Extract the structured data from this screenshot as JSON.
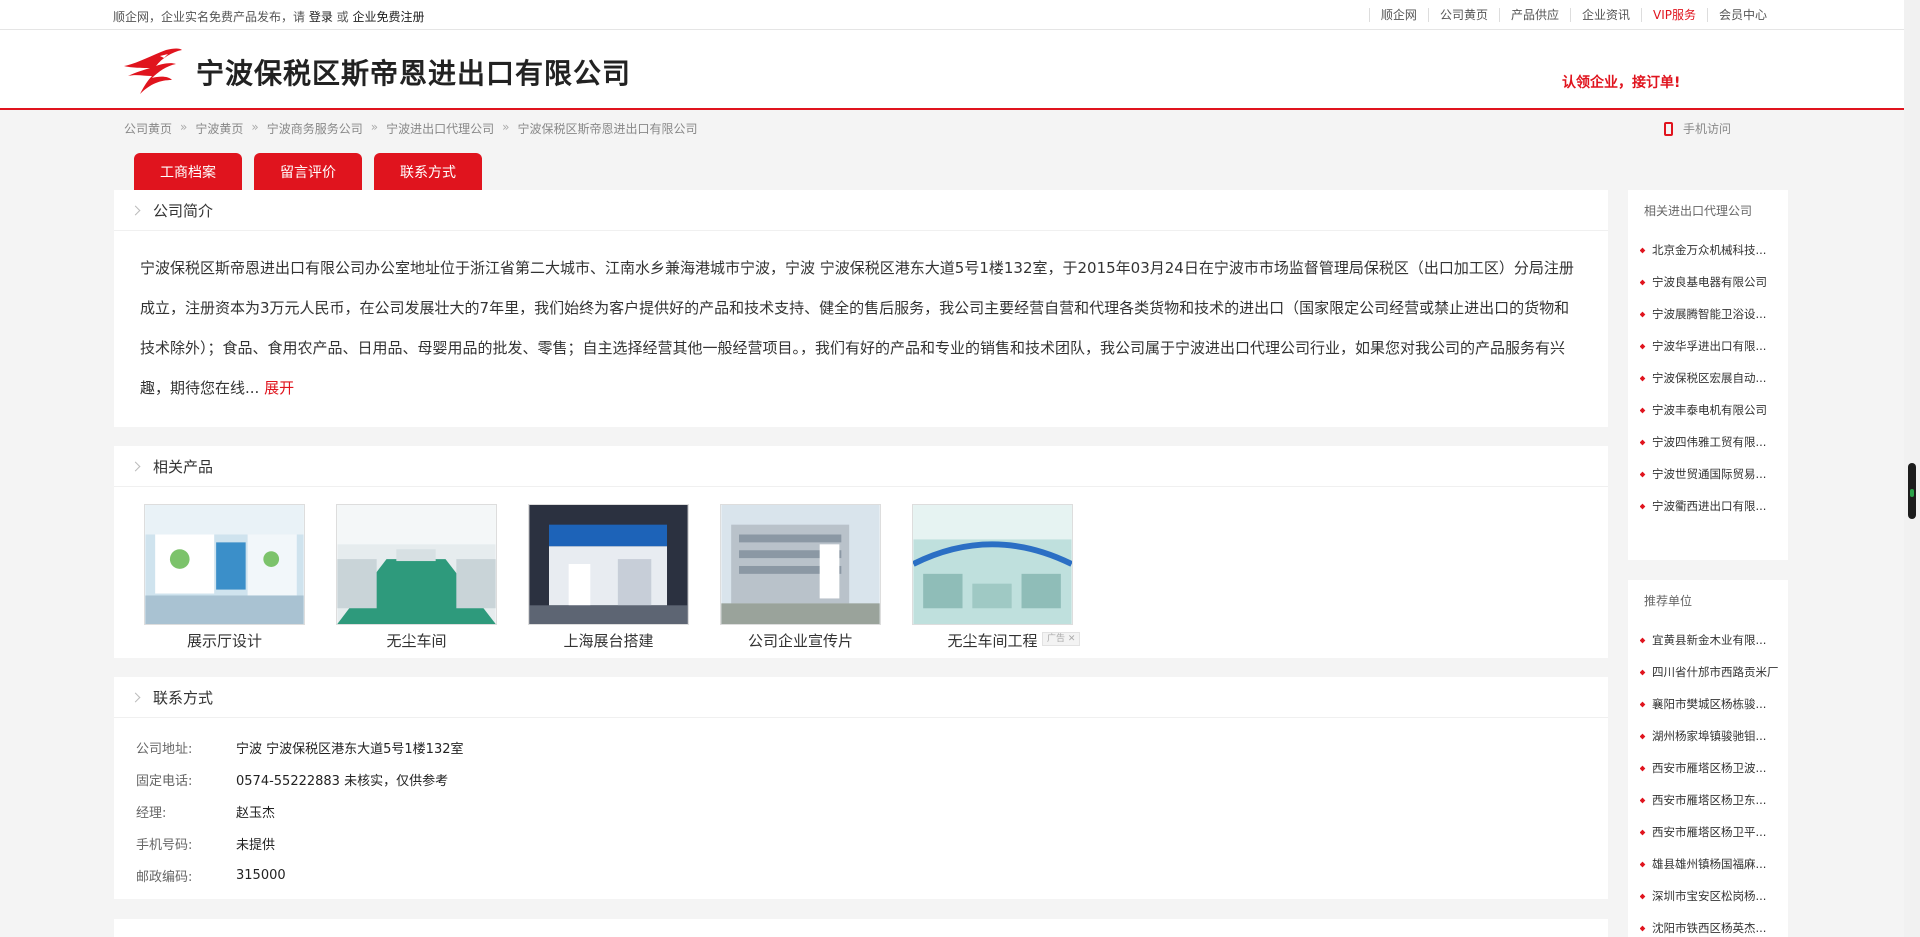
{
  "topbar": {
    "intro": "顺企网，企业实名免费产品发布，请 ",
    "login": "登录",
    "or": " 或 ",
    "register": "企业免费注册",
    "nav": [
      "顺企网",
      "公司黄页",
      "产品供应",
      "企业资讯",
      "VIP服务",
      "会员中心"
    ]
  },
  "header": {
    "company_name": "宁波保税区斯帝恩进出口有限公司",
    "claim": "认领企业，接订单!"
  },
  "breadcrumb": [
    "公司黄页",
    "宁波黄页",
    "宁波商务服务公司",
    "宁波进出口代理公司",
    "宁波保税区斯帝恩进出口有限公司"
  ],
  "breadcrumb_sep": "»",
  "mobile_label": "手机访问",
  "tabs": [
    "工商档案",
    "留言评价",
    "联系方式"
  ],
  "intro": {
    "title": "公司简介",
    "text": "宁波保税区斯帝恩进出口有限公司办公室地址位于浙江省第二大城市、江南水乡兼海港城市宁波，宁波 宁波保税区港东大道5号1楼132室，于2015年03月24日在宁波市市场监督管理局保税区（出口加工区）分局注册成立，注册资本为3万元人民币，在公司发展壮大的7年里，我们始终为客户提供好的产品和技术支持、健全的售后服务，我公司主要经营自营和代理各类货物和技术的进出口（国家限定公司经营或禁止进出口的货物和技术除外）；食品、食用农产品、日用品、母婴用品的批发、零售；自主选择经营其他一般经营项目。，我们有好的产品和专业的销售和技术团队，我公司属于宁波进出口代理公司行业，如果您对我公司的产品服务有兴趣，期待您在线...",
    "expand": "展开"
  },
  "products": {
    "title": "相关产品",
    "items": [
      {
        "caption": "展示厅设计"
      },
      {
        "caption": "无尘车间"
      },
      {
        "caption": "上海展台搭建"
      },
      {
        "caption": "公司企业宣传片"
      },
      {
        "caption": "无尘车间工程"
      }
    ],
    "ad_label": "广告"
  },
  "contact": {
    "title": "联系方式",
    "rows": [
      {
        "label": "公司地址:",
        "value": "宁波 宁波保税区港东大道5号1楼132室"
      },
      {
        "label": "固定电话:",
        "value": "0574-55222883 未核实，仅供参考"
      },
      {
        "label": "经理:",
        "value": "赵玉杰"
      },
      {
        "label": "手机号码:",
        "value": "未提供"
      },
      {
        "label": "邮政编码:",
        "value": "315000"
      }
    ]
  },
  "sidebar_related": {
    "title": "相关进出口代理公司",
    "items": [
      "北京金万众机械科技...",
      "宁波良基电器有限公司",
      "宁波展腾智能卫浴设...",
      "宁波华孚进出口有限...",
      "宁波保税区宏展自动...",
      "宁波丰泰电机有限公司",
      "宁波四伟雅工贸有限...",
      "宁波世贸通国际贸易...",
      "宁波衢西进出口有限..."
    ]
  },
  "sidebar_recommended": {
    "title": "推荐单位",
    "items": [
      "宜黄县新金木业有限...",
      "四川省什邡市西路贡米厂",
      "襄阳市樊城区杨栋骏...",
      "湖州杨家埠镇骏驰钼...",
      "西安市雁塔区杨卫波...",
      "西安市雁塔区杨卫东...",
      "西安市雁塔区杨卫平...",
      "雄县雄州镇杨国福麻...",
      "深圳市宝安区松岗杨...",
      "沈阳市铁西区杨英杰..."
    ]
  },
  "colors": {
    "accent": "#e0141e"
  }
}
